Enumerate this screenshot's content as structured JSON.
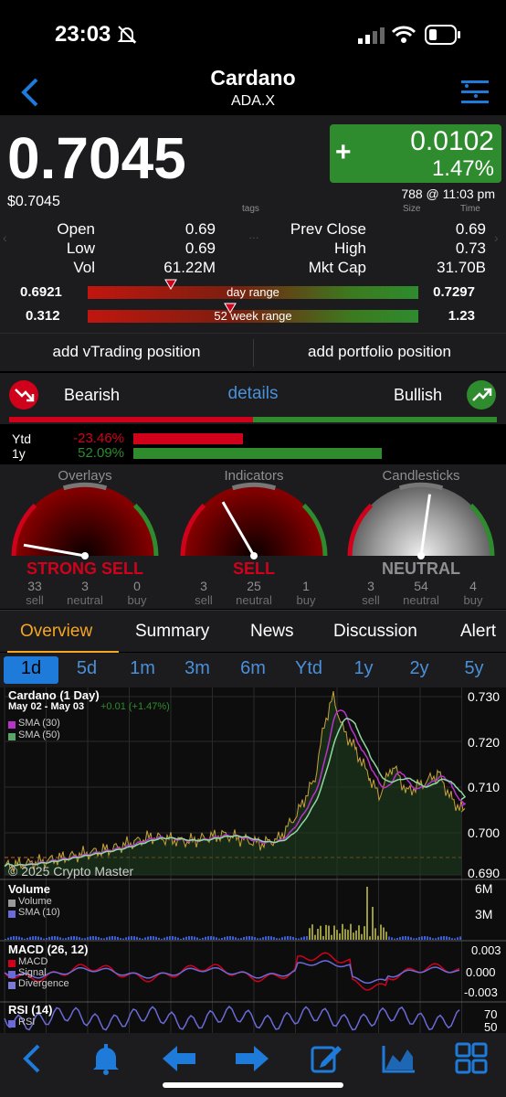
{
  "status_bar": {
    "time": "23:03"
  },
  "header": {
    "title": "Cardano",
    "symbol": "ADA.X"
  },
  "quote": {
    "price": "0.7045",
    "price_dollar": "$0.7045",
    "change": "0.0102",
    "change_pct": "1.47%",
    "change_sign": "+",
    "trade_info": "788 @ 11:03 pm",
    "tags_label": "tags",
    "size_label": "Size",
    "time_label": "Time"
  },
  "stats": {
    "open_label": "Open",
    "open": "0.69",
    "prev_close_label": "Prev Close",
    "prev_close": "0.69",
    "low_label": "Low",
    "low": "0.69",
    "high_label": "High",
    "high": "0.73",
    "vol_label": "Vol",
    "vol": "61.22M",
    "mkt_cap_label": "Mkt Cap",
    "mkt_cap": "31.70B",
    "day_range": {
      "low": "0.6921",
      "high": "0.7297",
      "label": "day range",
      "position": 0.25
    },
    "week52_range": {
      "low": "0.312",
      "high": "1.23",
      "label": "52 week range",
      "position": 0.43
    }
  },
  "actions": {
    "add_vtrading": "add vTrading position",
    "add_portfolio": "add portfolio position"
  },
  "sentiment": {
    "bearish": "Bearish",
    "details": "details",
    "bullish": "Bullish",
    "bearish_fraction": 0.5
  },
  "performance": {
    "ytd_label": "Ytd",
    "ytd_value": "-23.46%",
    "ytd_fraction": 0.3,
    "y1_label": "1y",
    "y1_value": "52.09%",
    "y1_fraction": 0.68
  },
  "gauges": [
    {
      "title": "Overlays",
      "verdict": "STRONG SELL",
      "sell": "33",
      "neutral": "3",
      "buy": "0",
      "verdict_color": "#d0021b",
      "needle_deg": -80
    },
    {
      "title": "Indicators",
      "verdict": "SELL",
      "sell": "3",
      "neutral": "25",
      "buy": "1",
      "verdict_color": "#d0021b",
      "needle_deg": -30
    },
    {
      "title": "Candlesticks",
      "verdict": "NEUTRAL",
      "sell": "3",
      "neutral": "54",
      "buy": "4",
      "verdict_color": "#8e8e93",
      "needle_deg": 8
    }
  ],
  "gauge_labels": {
    "sell": "sell",
    "neutral": "neutral",
    "buy": "buy"
  },
  "tabs": [
    "Overview",
    "Summary",
    "News",
    "Discussion",
    "Alert"
  ],
  "ranges": [
    "1d",
    "5d",
    "1m",
    "3m",
    "6m",
    "Ytd",
    "1y",
    "2y",
    "5y"
  ],
  "chart": {
    "title": "Cardano (1 Day)",
    "date_range": "May 02 - May 03",
    "change": "+0.01 (+1.47%)",
    "sma30": "SMA (30)",
    "sma50": "SMA (50)",
    "copyright": "© 2025 Crypto Master",
    "y_ticks": [
      "0.730",
      "0.720",
      "0.710",
      "0.700",
      "0.690"
    ],
    "volume_title": "Volume",
    "volume_legend": "Volume",
    "volume_sma": "SMA (10)",
    "volume_ticks": [
      "6M",
      "3M"
    ],
    "macd_title": "MACD (26, 12)",
    "macd_legend": "MACD",
    "signal_legend": "Signal",
    "divergence_legend": "Divergence",
    "macd_ticks": [
      "0.003",
      "0.000",
      "-0.003"
    ],
    "rsi_title": "RSI (14)",
    "rsi_legend": "RSI",
    "rsi_ticks": [
      "70",
      "50"
    ]
  },
  "colors": {
    "green": "#2e8b2e",
    "red": "#d0021b",
    "blue": "#4a90d9",
    "panel": "#1c1c1e"
  }
}
